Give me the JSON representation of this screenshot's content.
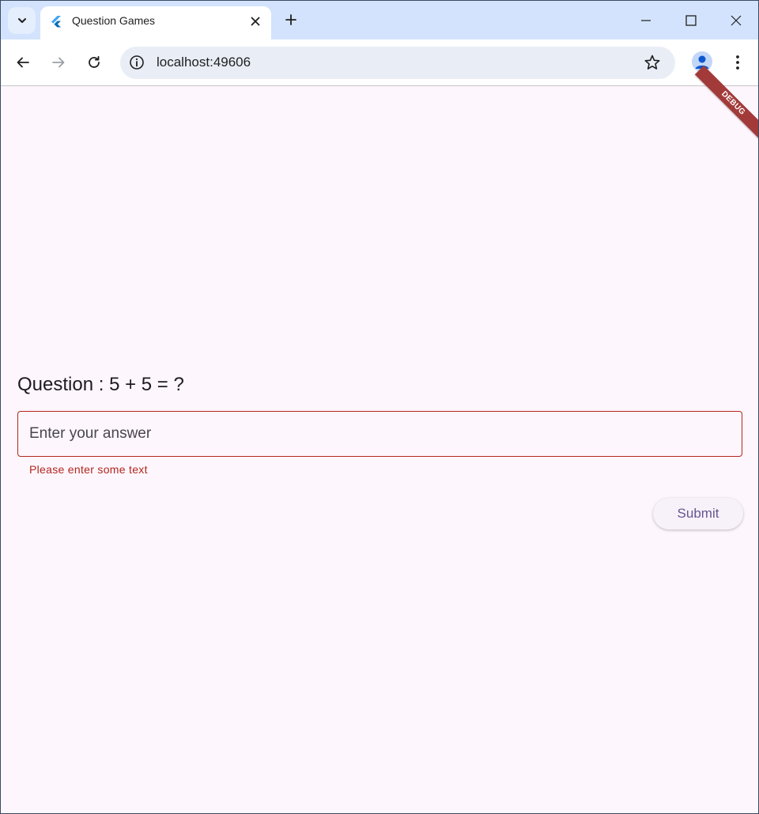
{
  "browser": {
    "tab": {
      "title": "Question Games"
    },
    "address_bar": {
      "url": "localhost:49606"
    }
  },
  "app": {
    "debug_banner": "DEBUG",
    "question_text": "Question : 5 + 5 = ?",
    "answer_input": {
      "placeholder": "Enter your answer",
      "value": "",
      "error": "Please enter some text"
    },
    "submit_label": "Submit"
  },
  "colors": {
    "error": "#b3261e",
    "page_background": "#fdf6fc",
    "button_text": "#65558f",
    "tabstrip": "#d3e3fd"
  }
}
